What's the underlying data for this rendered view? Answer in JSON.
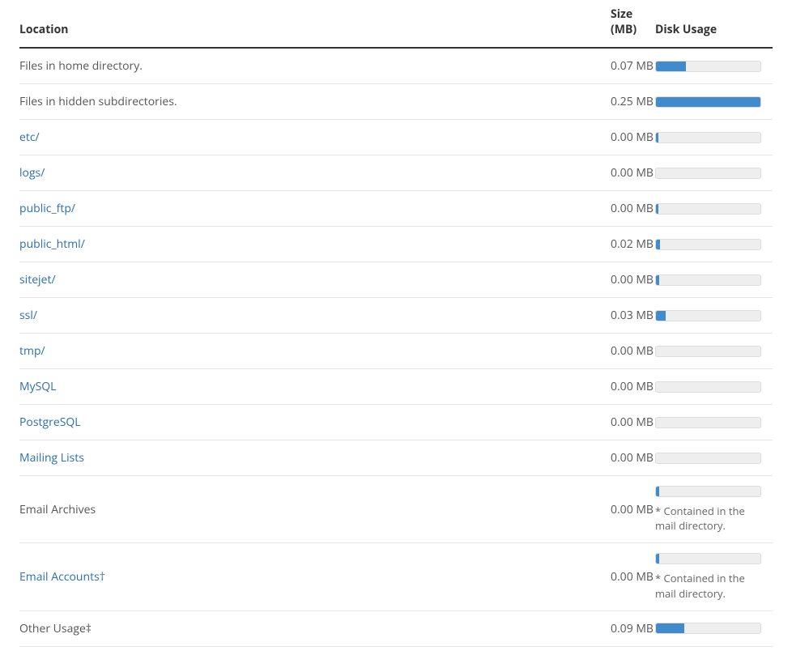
{
  "headers": {
    "location": "Location",
    "size": "Size (MB)",
    "usage": "Disk Usage"
  },
  "rows": [
    {
      "label": "Files in home directory.",
      "link": false,
      "size": "0.07 MB",
      "bar_pct": 29,
      "note": ""
    },
    {
      "label": "Files in hidden subdirectories.",
      "link": false,
      "size": "0.25 MB",
      "bar_pct": 100,
      "note": ""
    },
    {
      "label": "etc/",
      "link": true,
      "size": "0.00 MB",
      "bar_pct": 2,
      "note": ""
    },
    {
      "label": "logs/",
      "link": true,
      "size": "0.00 MB",
      "bar_pct": 0,
      "note": ""
    },
    {
      "label": "public_ftp/",
      "link": true,
      "size": "0.00 MB",
      "bar_pct": 2,
      "note": ""
    },
    {
      "label": "public_html/",
      "link": true,
      "size": "0.02 MB",
      "bar_pct": 4,
      "note": ""
    },
    {
      "label": "sitejet/",
      "link": true,
      "size": "0.00 MB",
      "bar_pct": 3,
      "note": ""
    },
    {
      "label": "ssl/",
      "link": true,
      "size": "0.03 MB",
      "bar_pct": 9,
      "note": ""
    },
    {
      "label": "tmp/",
      "link": true,
      "size": "0.00 MB",
      "bar_pct": 0,
      "note": ""
    },
    {
      "label": "MySQL",
      "link": true,
      "size": "0.00 MB",
      "bar_pct": 0,
      "note": ""
    },
    {
      "label": "PostgreSQL",
      "link": true,
      "size": "0.00 MB",
      "bar_pct": 0,
      "note": ""
    },
    {
      "label": "Mailing Lists",
      "link": true,
      "size": "0.00 MB",
      "bar_pct": 0,
      "note": ""
    },
    {
      "label": "Email Archives",
      "link": false,
      "size": "0.00 MB",
      "bar_pct": 3,
      "note": "* Contained in the mail directory."
    },
    {
      "label": "Email Accounts†",
      "link": true,
      "size": "0.00 MB",
      "bar_pct": 3,
      "note": "* Contained in the mail directory."
    },
    {
      "label": "Other Usage‡",
      "link": false,
      "size": "0.09 MB",
      "bar_pct": 27,
      "note": ""
    }
  ]
}
